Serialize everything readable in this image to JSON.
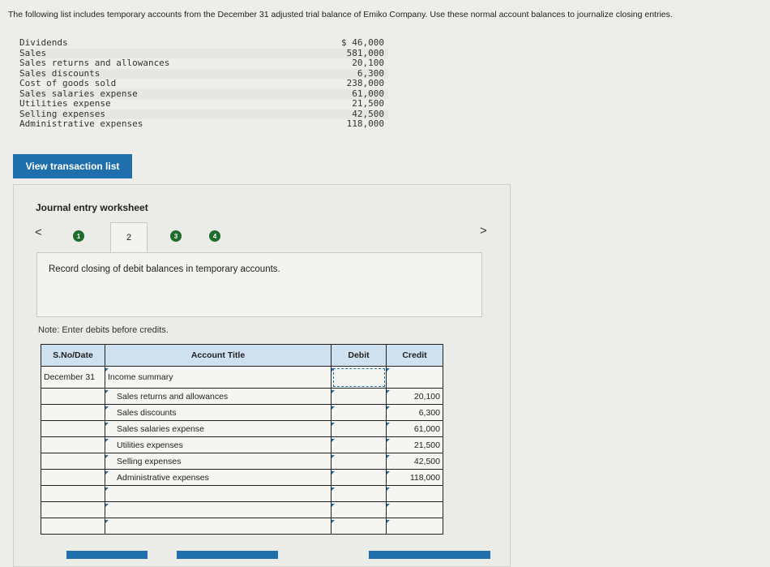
{
  "prompt": "The following list includes temporary accounts from the December 31 adjusted trial balance of Emiko Company. Use these normal account balances to journalize closing entries.",
  "balances": [
    {
      "name": "Dividends",
      "amount": "$ 46,000"
    },
    {
      "name": "Sales",
      "amount": "581,000"
    },
    {
      "name": "Sales returns and allowances",
      "amount": "20,100"
    },
    {
      "name": "Sales discounts",
      "amount": "6,300"
    },
    {
      "name": "Cost of goods sold",
      "amount": "238,000"
    },
    {
      "name": "Sales salaries expense",
      "amount": "61,000"
    },
    {
      "name": "Utilities expense",
      "amount": "21,500"
    },
    {
      "name": "Selling expenses",
      "amount": "42,500"
    },
    {
      "name": "Administrative expenses",
      "amount": "118,000"
    }
  ],
  "view_button": "View transaction list",
  "worksheet": {
    "title": "Journal entry worksheet",
    "prev": "<",
    "next": ">",
    "steps": [
      "1",
      "2",
      "3",
      "4"
    ],
    "active_step": "2",
    "instruction": "Record closing of debit balances in temporary accounts.",
    "note": "Note: Enter debits before credits."
  },
  "table": {
    "headers": {
      "date": "S.No/Date",
      "account": "Account Title",
      "debit": "Debit",
      "credit": "Credit"
    },
    "rows": [
      {
        "date": "December 31",
        "account": "Income summary",
        "debit": "",
        "credit": ""
      },
      {
        "date": "",
        "account": "Sales returns and allowances",
        "debit": "",
        "credit": "20,100"
      },
      {
        "date": "",
        "account": "Sales discounts",
        "debit": "",
        "credit": "6,300"
      },
      {
        "date": "",
        "account": "Sales salaries expense",
        "debit": "",
        "credit": "61,000"
      },
      {
        "date": "",
        "account": "Utilities expenses",
        "debit": "",
        "credit": "21,500"
      },
      {
        "date": "",
        "account": "Selling expenses",
        "debit": "",
        "credit": "42,500"
      },
      {
        "date": "",
        "account": "Administrative expenses",
        "debit": "",
        "credit": "118,000"
      },
      {
        "date": "",
        "account": "",
        "debit": "",
        "credit": ""
      },
      {
        "date": "",
        "account": "",
        "debit": "",
        "credit": ""
      },
      {
        "date": "",
        "account": "",
        "debit": "",
        "credit": ""
      }
    ]
  },
  "colors": {
    "accent": "#1f6fad",
    "step": "#1f6b2c",
    "header": "#cfe0ee"
  }
}
